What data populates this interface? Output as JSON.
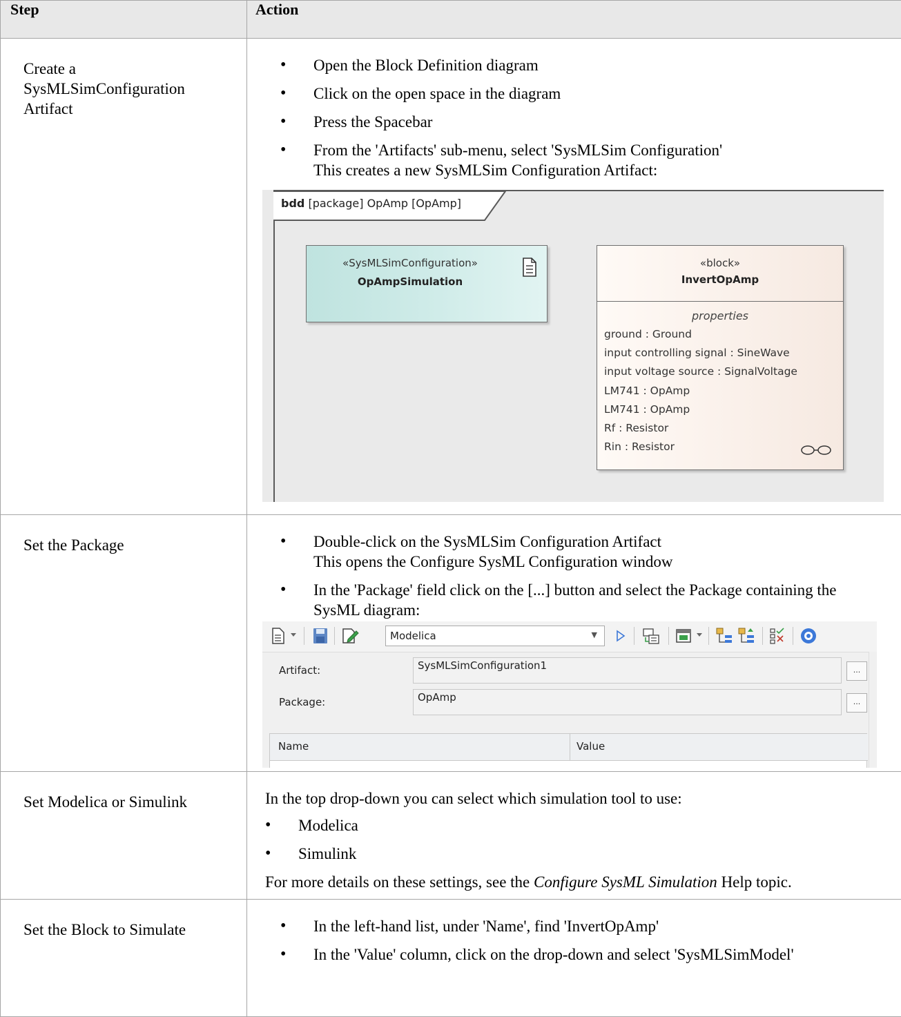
{
  "table": {
    "header": {
      "step": "Step",
      "action": "Action"
    }
  },
  "rows": [
    {
      "step_lines": [
        "Create a",
        "SysMLSimConfiguration",
        "Artifact"
      ],
      "bullets": [
        "Open the Block Definition diagram",
        "Click on the open space in the diagram",
        "Press the Spacebar",
        "From the 'Artifacts' sub-menu, select 'SysMLSim Configuration'"
      ],
      "bullet4_sub": "This creates a new SysMLSim Configuration Artifact:"
    },
    {
      "step": "Set the Package",
      "bullet1": "Double-click on the SysMLSim Configuration Artifact",
      "bullet1_sub": "This opens the Configure SysML Configuration window",
      "bullet2": "In the 'Package' field click on the [...] button and select the Package containing the SysML diagram:"
    },
    {
      "step": "Set Modelica or Simulink",
      "intro": "In the top drop-down you can select which simulation tool to use:",
      "bullets": [
        "Modelica",
        "Simulink"
      ],
      "note_before": "For more details on these settings, see the ",
      "note_link": "Configure SysML Simulation",
      "note_after": " Help topic."
    },
    {
      "step": "Set the Block to Simulate",
      "bullets": [
        "In the left-hand list, under 'Name', find 'InvertOpAmp'",
        "In the 'Value' column, click on the drop-down and select 'SysMLSimModel'"
      ]
    }
  ],
  "diagram": {
    "frame_kind": "bdd",
    "frame_label": " [package] OpAmp [OpAmp]",
    "artifact": {
      "stereotype": "«SysMLSimConfiguration»",
      "name": "OpAmpSimulation",
      "icon": "document-icon"
    },
    "block": {
      "stereotype": "«block»",
      "name": "InvertOpAmp",
      "compartment": "properties",
      "properties": [
        "ground : Ground",
        "input controlling signal : SineWave",
        "input voltage source : SignalVoltage",
        "LM741 : OpAmp",
        "LM741 : OpAmp",
        "Rf : Resistor",
        "Rin : Resistor"
      ],
      "icon": "glasses-icon"
    },
    "colors": {
      "artifact_fill": "#c9e9e5",
      "block_fill": "#f7ebe3",
      "canvas": "#eaeaea"
    }
  },
  "config_window": {
    "toolbar_icons": [
      "new-doc-icon",
      "dropdown-arrow-icon",
      "save-icon",
      "edit-icon",
      "run-icon",
      "generate-icon",
      "window-icon",
      "dropdown-arrow-icon",
      "tree-down-icon",
      "tree-up-icon",
      "checklist-icon",
      "help-icon"
    ],
    "tool_select": "Modelica",
    "artifact_label": "Artifact:",
    "artifact_value": "SysMLSimConfiguration1",
    "package_label": "Package:",
    "package_value": "OpAmp",
    "ellipsis": "...",
    "grid_headers": [
      "Name",
      "Value"
    ]
  }
}
